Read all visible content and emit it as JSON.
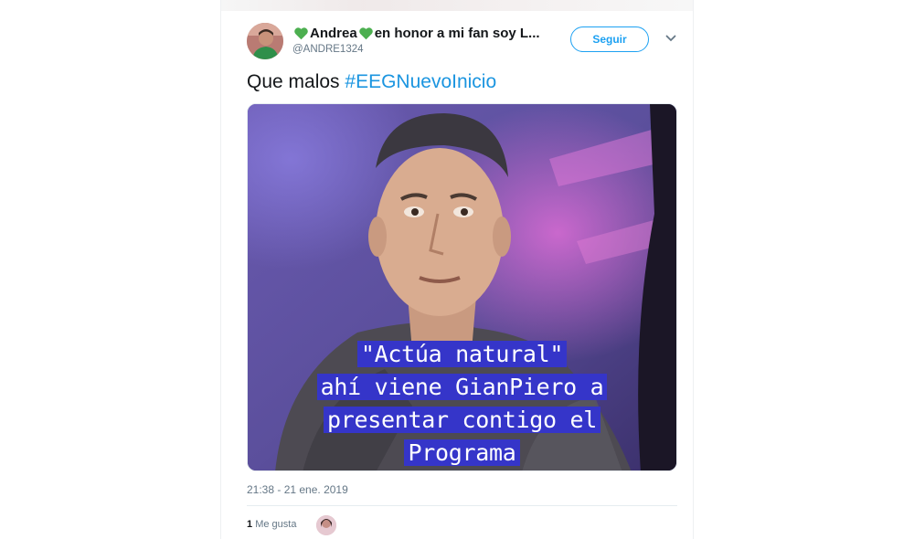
{
  "tweet": {
    "display_name_parts": [
      "Andrea",
      "en honor a mi fan soy L..."
    ],
    "handle": "@ANDRE1324",
    "follow_label": "Seguir",
    "text_plain": "Que malos ",
    "hashtag": "#EEGNuevoInicio",
    "timestamp": "21:38 - 21 ene. 2019",
    "likes_count": "1",
    "likes_label": "Me gusta"
  },
  "media": {
    "caption_lines": [
      "\"Actúa natural\"",
      "ahí viene GianPiero a",
      "presentar contigo el",
      "Programa"
    ]
  },
  "icons": {
    "heart": "green-heart-emoji",
    "caret": "chevron-down-icon"
  },
  "colors": {
    "accent": "#1da1f2",
    "hashtag": "#1b95e0",
    "heart": "#4caf50",
    "caption_bg": "#3535c9"
  }
}
